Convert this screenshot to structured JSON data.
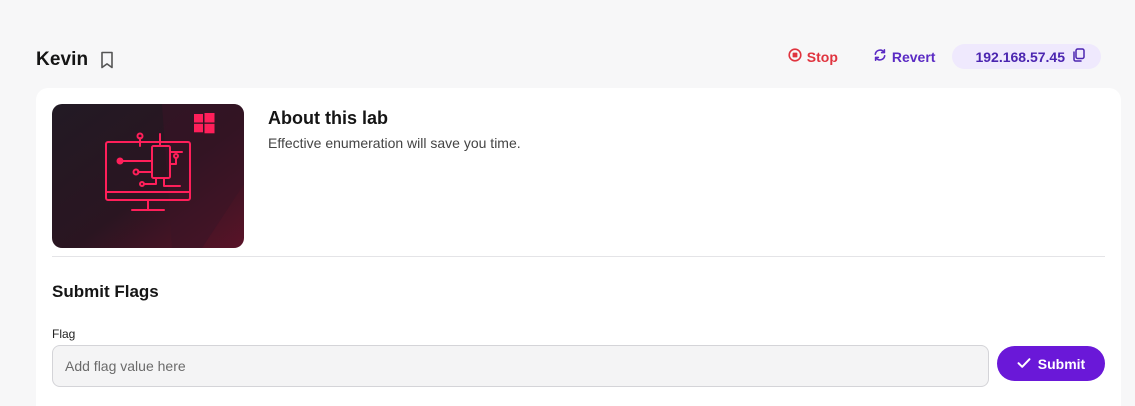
{
  "lab": {
    "title": "Kevin"
  },
  "actions": {
    "stop_label": "Stop",
    "revert_label": "Revert",
    "ip_address": "192.168.57.45"
  },
  "about": {
    "title": "About this lab",
    "description": "Effective enumeration will save you time."
  },
  "flags": {
    "title": "Submit Flags",
    "field_label": "Flag",
    "placeholder": "Add flag value here",
    "value": "",
    "submit_label": "Submit"
  },
  "icons": {
    "bookmark": "bookmark-icon",
    "stop": "stop-circle-icon",
    "revert": "refresh-icon",
    "copy": "copy-icon",
    "windows": "windows-logo-icon",
    "submit": "check-icon"
  },
  "colors": {
    "stop": "#e0343f",
    "accent": "#6a18d8",
    "revert": "#5b2bc4",
    "ip_pill_bg": "#efe9fd",
    "lab_art": "#ff1f5a"
  }
}
